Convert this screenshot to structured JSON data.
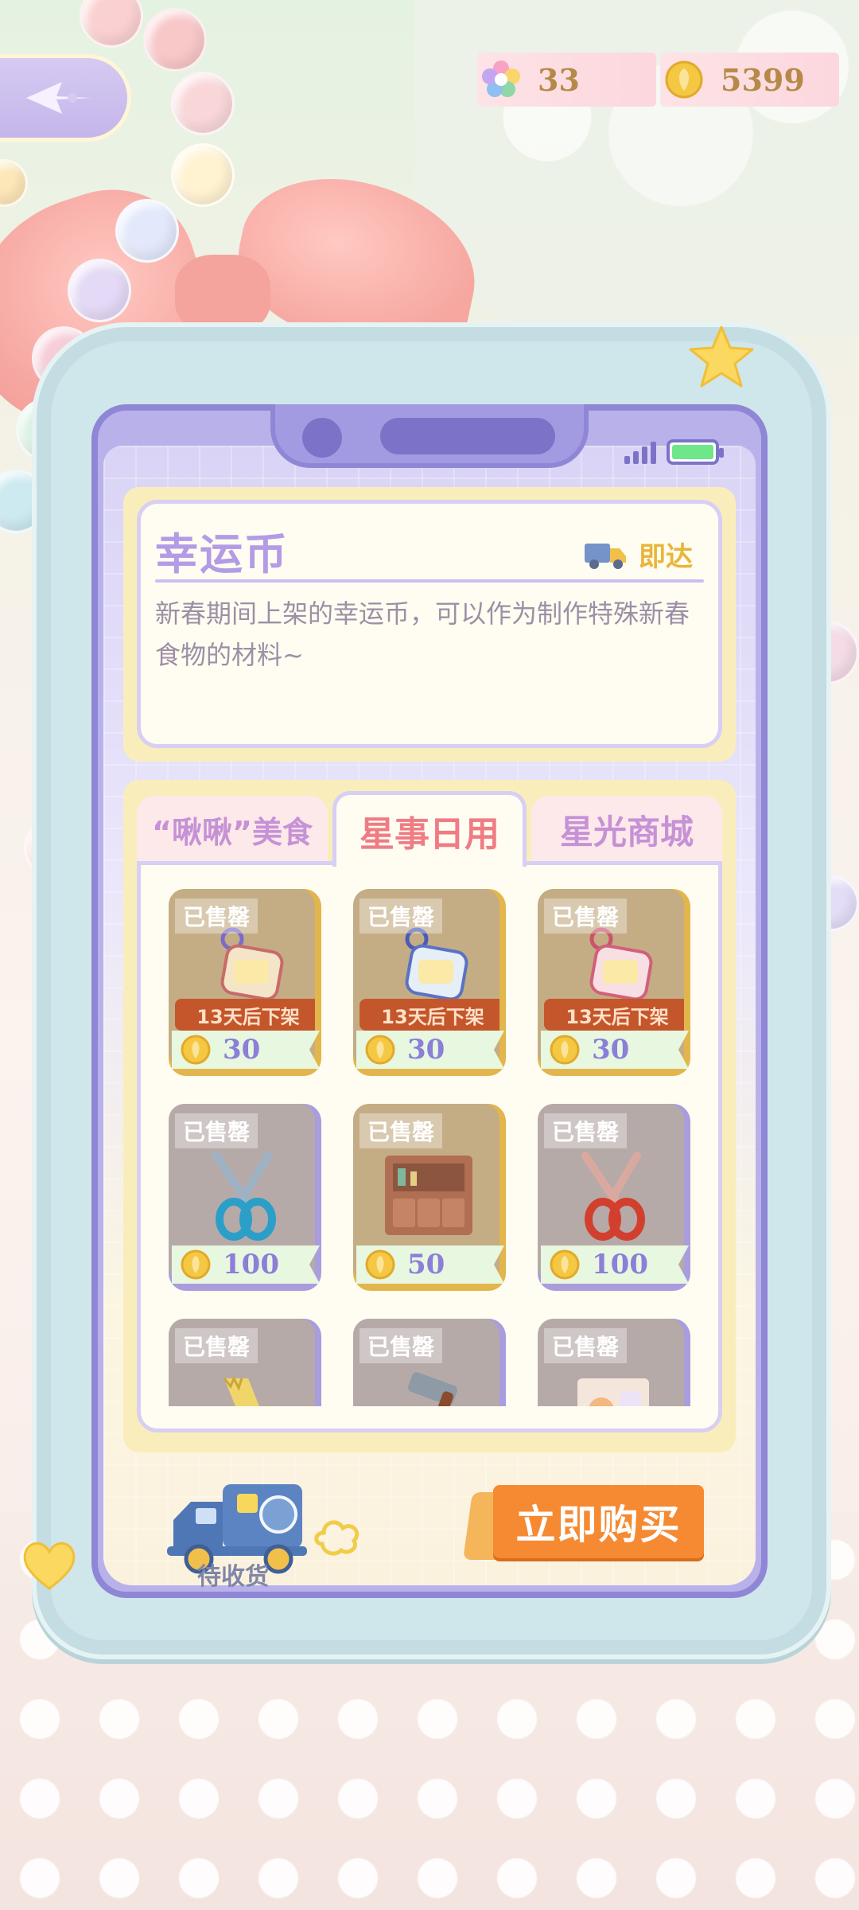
{
  "top_bar": {
    "gems": "33",
    "coins": "5399"
  },
  "item_detail": {
    "title": "幸运币",
    "delivery_label": "即达",
    "description": "新春期间上架的幸运币，可以作为制作特殊新春食物的材料~"
  },
  "tabs": [
    {
      "label": "“啾啾”美食",
      "active": false
    },
    {
      "label": "星事日用",
      "active": true
    },
    {
      "label": "星光商城",
      "active": false
    }
  ],
  "products": [
    {
      "sold_label": "已售罄",
      "timer": "13天后下架",
      "price": "30",
      "icon": "keychain-icon",
      "frame": "gold"
    },
    {
      "sold_label": "已售罄",
      "timer": "13天后下架",
      "price": "30",
      "icon": "keychain-icon",
      "frame": "gold"
    },
    {
      "sold_label": "已售罄",
      "timer": "13天后下架",
      "price": "30",
      "icon": "keychain-icon",
      "frame": "gold"
    },
    {
      "sold_label": "已售罄",
      "timer": "",
      "price": "100",
      "icon": "blue-scissors-icon",
      "frame": "purple"
    },
    {
      "sold_label": "已售罄",
      "timer": "",
      "price": "50",
      "icon": "cabinet-icon",
      "frame": "gold"
    },
    {
      "sold_label": "已售罄",
      "timer": "",
      "price": "100",
      "icon": "red-scissors-icon",
      "frame": "purple"
    },
    {
      "sold_label": "已售罄",
      "timer": "",
      "price": "",
      "icon": "saw-icon",
      "frame": "purple"
    },
    {
      "sold_label": "已售罄",
      "timer": "",
      "price": "",
      "icon": "hammer-icon",
      "frame": "purple"
    },
    {
      "sold_label": "已售罄",
      "timer": "",
      "price": "",
      "icon": "paper-icon",
      "frame": "purple"
    }
  ],
  "bottom": {
    "pending_label": "待收货",
    "buy_label": "立即购买"
  },
  "colors": {
    "accent_purple": "#b39be6",
    "buy_orange": "#f58a33",
    "active_tab": "#ef7c84"
  }
}
